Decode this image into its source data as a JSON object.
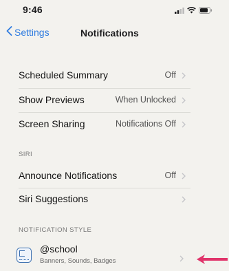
{
  "status_bar": {
    "time": "9:46"
  },
  "nav": {
    "back_label": "Settings",
    "title": "Notifications"
  },
  "rows_top": [
    {
      "label": "Scheduled Summary",
      "value": "Off"
    },
    {
      "label": "Show Previews",
      "value": "When Unlocked"
    },
    {
      "label": "Screen Sharing",
      "value": "Notifications Off"
    }
  ],
  "siri": {
    "header": "SIRI",
    "rows": [
      {
        "label": "Announce Notifications",
        "value": "Off"
      },
      {
        "label": "Siri Suggestions",
        "value": ""
      }
    ]
  },
  "notification_style": {
    "header": "NOTIFICATION STYLE",
    "app": {
      "name": "@school",
      "subtitle": "Banners, Sounds, Badges"
    }
  },
  "colors": {
    "accent": "#2f7ce0",
    "arrow": "#e0336a",
    "background": "#f3f2ee"
  }
}
